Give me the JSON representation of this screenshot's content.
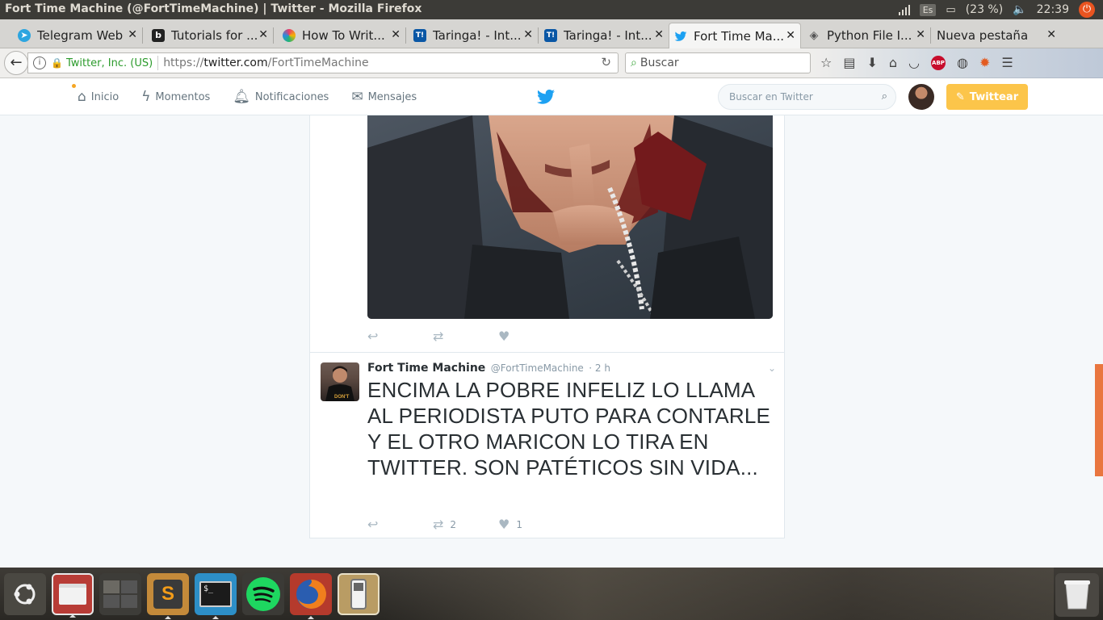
{
  "window": {
    "title": "Fort Time Machine (@FortTimeMachine) | Twitter - Mozilla Firefox",
    "indicators": {
      "keyboard": "Es",
      "battery": "(23 %)",
      "clock": "22:39"
    }
  },
  "tabs": [
    {
      "label": "Telegram Web",
      "icon": "telegram-icon",
      "color": "#2ca5e0",
      "glyph": "➤"
    },
    {
      "label": "Tutorials for ...",
      "icon": "b-icon",
      "color": "#222222",
      "glyph": "b"
    },
    {
      "label": "How To Writ...",
      "icon": "colorful-circle-icon",
      "color": "#e93b6b",
      "glyph": "◉"
    },
    {
      "label": "Taringa! - Int...",
      "icon": "taringa-icon",
      "color": "#0a57a5",
      "glyph": "T!"
    },
    {
      "label": "Taringa! - Int...",
      "icon": "taringa-icon",
      "color": "#0a57a5",
      "glyph": "T!"
    },
    {
      "label": "Fort Time Ma...",
      "icon": "twitter-bird-icon",
      "color": "#1da1f2",
      "glyph": "🐦",
      "active": true
    },
    {
      "label": "Python File I...",
      "icon": "python-doc-icon",
      "color": "#555555",
      "glyph": "◈"
    },
    {
      "label": "Nueva pestaña",
      "icon": "",
      "color": "",
      "glyph": ""
    }
  ],
  "navbar": {
    "identity": "Twitter, Inc. (US)",
    "url_prefix": "https://",
    "url_domain": "twitter.com",
    "url_path": "/FortTimeMachine",
    "search_placeholder": "Buscar"
  },
  "twitter": {
    "nav": {
      "home": "Inicio",
      "moments": "Momentos",
      "notifications": "Notificaciones",
      "messages": "Mensajes"
    },
    "search_placeholder": "Buscar en Twitter",
    "tweet_button": "Twittear"
  },
  "tweet": {
    "name": "Fort Time Machine",
    "handle": "@FortTimeMachine",
    "time": "· 2 h",
    "text": "ENCIMA LA POBRE INFELIZ LO LLAMA AL PERIODISTA PUTO PARA CONTARLE Y EL OTRO MARICON LO TIRA EN TWITTER. SON PATÉTICOS SIN VIDA...",
    "retweets": "2",
    "likes": "1"
  },
  "colors": {
    "twitter_blue": "#1da1f2",
    "tweet_button": "#fcc54a",
    "ubuntu_orange": "#e95420"
  }
}
